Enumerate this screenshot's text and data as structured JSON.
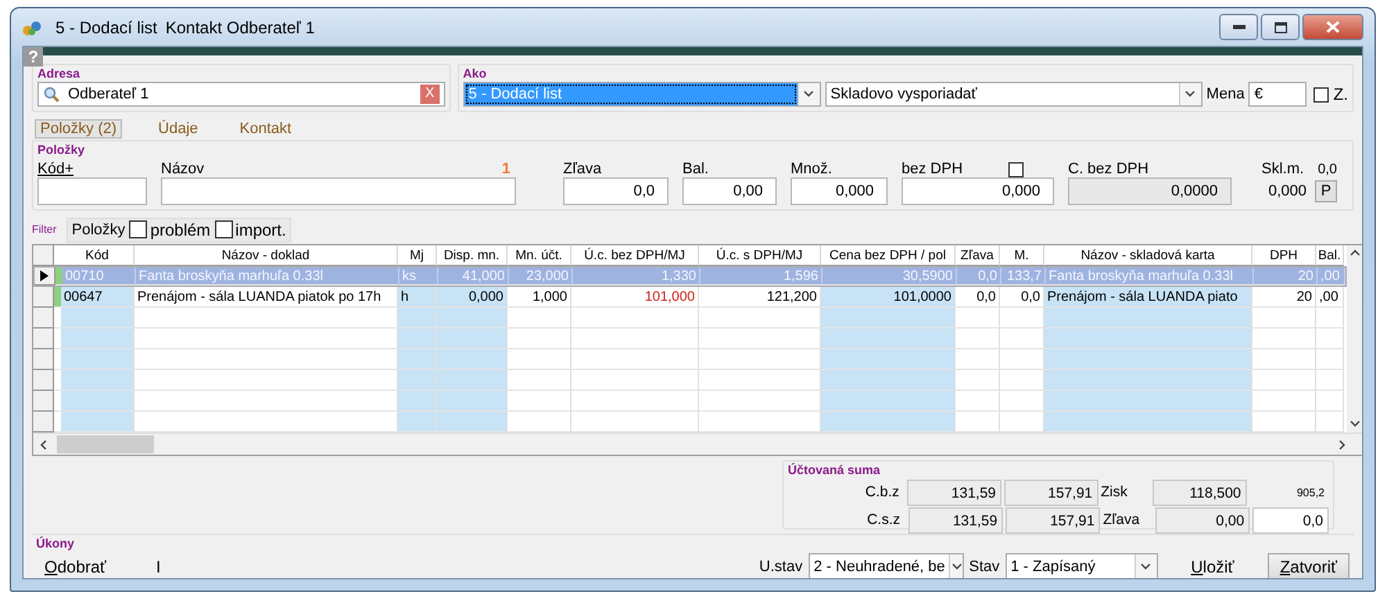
{
  "window": {
    "title": "5 - Dodací list",
    "subtitle": "Kontakt Odberateľ 1",
    "help": "?"
  },
  "address": {
    "label": "Adresa",
    "value": "Odberateľ 1",
    "clear": "X"
  },
  "document": {
    "label": "Ako",
    "type": "5 - Dodací list",
    "type_selected": true,
    "mode": "Skladovo vysporiadať",
    "currency_label": "Mena",
    "currency": "€",
    "z_label": "Z.",
    "z_checked": false
  },
  "tabs": [
    {
      "label": "Položky (2)",
      "selected": true
    },
    {
      "label": "Údaje",
      "selected": false
    },
    {
      "label": "Kontakt",
      "selected": false
    }
  ],
  "entry": {
    "label": "Položky",
    "fields": [
      {
        "label": "Kód+",
        "underlined": true
      },
      {
        "label": "Názov",
        "counter": "1"
      },
      {
        "label": "Zľava",
        "value": "0,0"
      },
      {
        "label": "Bal.",
        "value": "0,00"
      },
      {
        "label": "Množ.",
        "value": "0,000"
      },
      {
        "label": "bez DPH",
        "value": "0,000",
        "checked": false
      },
      {
        "label": "C. bez DPH",
        "value": "0,0000",
        "disabled": true
      }
    ],
    "stock": {
      "label": "Skl.m.",
      "reading": "0,0",
      "value": "0,000",
      "button": "P"
    }
  },
  "filter": {
    "label": "Filter",
    "scope": "Položky",
    "options": [
      {
        "label": "problém",
        "checked": false
      },
      {
        "label": "import.",
        "checked": false
      }
    ]
  },
  "table": {
    "columns": [
      {
        "label": "Kód",
        "tinted": true
      },
      {
        "label": "Názov - doklad",
        "tinted": false
      },
      {
        "label": "Mj",
        "tinted": true
      },
      {
        "label": "Disp. mn.",
        "tinted": true
      },
      {
        "label": "Mn. účt.",
        "tinted": false
      },
      {
        "label": "Ú.c. bez DPH/MJ",
        "tinted": false
      },
      {
        "label": "Ú.c. s DPH/MJ",
        "tinted": false
      },
      {
        "label": "Cena bez DPH / pol",
        "tinted": true
      },
      {
        "label": "Zľava",
        "tinted": false
      },
      {
        "label": "M.",
        "tinted": false
      },
      {
        "label": "Názov - skladová karta",
        "tinted": true
      },
      {
        "label": "DPH",
        "tinted": false
      },
      {
        "label": "Bal.",
        "tinted": false
      }
    ],
    "rows": [
      {
        "selected": true,
        "current": true,
        "price_flagged": false,
        "cells": [
          "00710",
          "Fanta broskyňa marhuľa 0.33l",
          "ks",
          "41,000",
          "23,000",
          "1,330",
          "1,596",
          "30,5900",
          "0,0",
          "133,7",
          "Fanta broskyňa marhuľa 0.33l",
          "20",
          ",00"
        ]
      },
      {
        "selected": false,
        "current": false,
        "price_flagged": true,
        "cells": [
          "00647",
          "Prenájom - sála LUANDA piatok po 17h",
          "h",
          "0,000",
          "1,000",
          "101,000",
          "121,200",
          "101,0000",
          "0,0",
          "0,0",
          "Prenájom - sála LUANDA piato",
          "20",
          ",00"
        ]
      }
    ]
  },
  "summary": {
    "label": "Účtovaná suma",
    "rows": [
      {
        "label": "C.b.z",
        "values": [
          "131,59",
          "157,91"
        ],
        "extra_label": "Zisk",
        "extra_value": "118,500",
        "note": "905,2"
      },
      {
        "label": "C.s.z",
        "values": [
          "131,59",
          "157,91"
        ],
        "extra_label": "Zľava",
        "extra_value": "0,00",
        "end_value": "0,0"
      }
    ]
  },
  "actions": {
    "label": "Úkony",
    "items": [
      {
        "label": "Odobrať",
        "accel": true
      },
      {
        "label": "I",
        "accel": false
      }
    ],
    "payment_label": "U.stav",
    "payment": "2 - Neuhradené, be",
    "state_label": "Stav",
    "state": "1 - Zapísaný",
    "buttons": [
      {
        "label": "Uložiť",
        "kind": "link",
        "accel": true
      },
      {
        "label": "Zatvoriť",
        "kind": "button",
        "accel": true
      }
    ]
  }
}
